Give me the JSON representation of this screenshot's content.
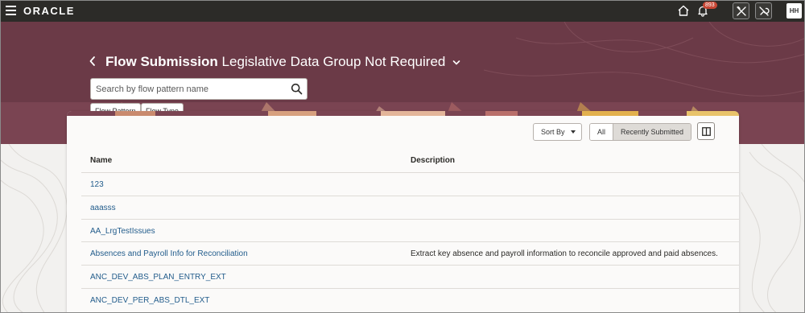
{
  "header": {
    "logo": "ORACLE",
    "notification_count": "893",
    "avatar_initials": "HH"
  },
  "page": {
    "title_bold": "Flow Submission",
    "title_rest": "Legislative Data Group Not Required"
  },
  "search": {
    "placeholder": "Search by flow pattern name"
  },
  "filters": [
    "Flow Pattern",
    "Flow Type"
  ],
  "toolbar": {
    "sort_label": "Sort By",
    "segments": [
      "All",
      "Recently Submitted"
    ]
  },
  "table": {
    "columns": [
      "Name",
      "Description"
    ],
    "rows": [
      {
        "name": "123",
        "description": ""
      },
      {
        "name": "aaasss",
        "description": ""
      },
      {
        "name": "AA_LrgTestIssues",
        "description": ""
      },
      {
        "name": "Absences and Payroll Info for Reconciliation",
        "description": "Extract key absence and payroll information to reconcile approved and paid absences."
      },
      {
        "name": "ANC_DEV_ABS_PLAN_ENTRY_EXT",
        "description": ""
      },
      {
        "name": "ANC_DEV_PER_ABS_DTL_EXT",
        "description": ""
      }
    ]
  },
  "colors": {
    "topbar": "#2c2b28",
    "hero": "#6b3a47",
    "link": "#235d8c",
    "badge": "#c74634"
  }
}
